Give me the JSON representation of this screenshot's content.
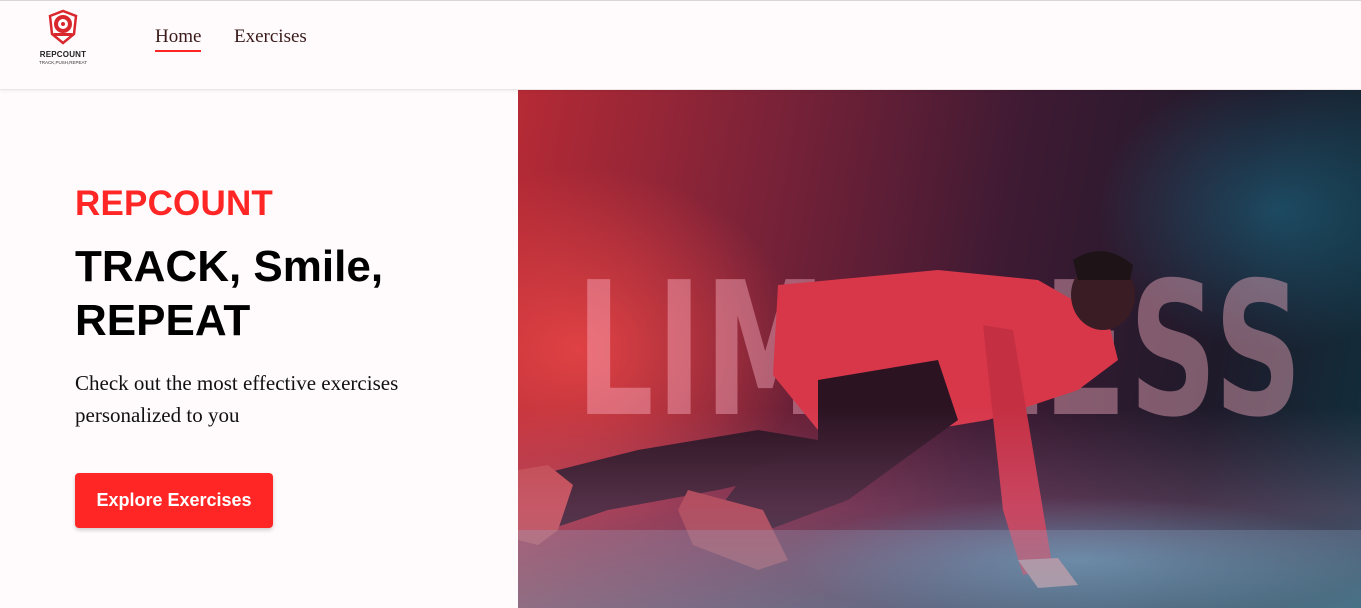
{
  "header": {
    "logo": {
      "name": "REPCOUNT",
      "tagline": "TRACK,PUSH,REPEAT",
      "icon": "dumbbell-weight-plate-icon"
    },
    "nav": {
      "items": [
        {
          "label": "Home",
          "active": true
        },
        {
          "label": "Exercises",
          "active": false
        }
      ]
    }
  },
  "hero": {
    "brand": "REPCOUNT",
    "headline": "TRACK, Smile, REPEAT",
    "subtext": "Check out the most effective exercises personalized to you",
    "cta_label": "Explore Exercises",
    "image": {
      "overlay_text": "LIMITLESS",
      "description": "athlete in sprint start position"
    }
  },
  "colors": {
    "accent": "#ff2625",
    "background": "#fffafb",
    "text": "#000000",
    "nav_text": "#3a1a1a"
  }
}
